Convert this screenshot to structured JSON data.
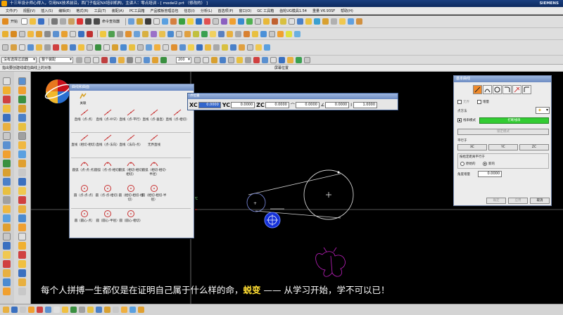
{
  "window": {
    "title": "十三年设计师心得入，引用NX技术前沿，西门子指定NX培训机构，主讲人：零点培训 - [ model2.prt （修改的） ]",
    "brand": "SIEMENS"
  },
  "menu": [
    "文件(F)",
    "视图(V)",
    "插入(S)",
    "编辑(E)",
    "格式(R)",
    "工具(T)",
    "装配(A)",
    "PC工具箱",
    "产品模板管理总包",
    "信息(I)",
    "分析(L)",
    "首选项(P)",
    "窗口(O)",
    "GC 工具箱",
    "齿轮UG模具1.54",
    "重量 V6.93SF",
    "帮助(H)"
  ],
  "toolbar1": {
    "start_label": "开始",
    "view_label": "命令查找器"
  },
  "selbar": {
    "filter": "没有选择过滤器",
    "scope": "整个装配",
    "zoom": "200"
  },
  "cue": {
    "left": "指出要创建线或在曲线上的对象",
    "status": "屏幕位置"
  },
  "curve_dialog": {
    "title": "曲线和曲面",
    "top_label": "关联",
    "items": [
      [
        "直线（点-点）",
        "直线（点-XYZ）",
        "直线（点-平行）",
        "直线（点-垂直）",
        "直线（点-相切）"
      ],
      [
        "直线（相切-相切）",
        "直线（点-法向）",
        "直线（法向-点）",
        "无界直线",
        ""
      ],
      [
        "圆弧（点-点-点）",
        "圆弧（点-点-相切）",
        "圆弧（相切-相切-相切）",
        "圆弧（相切-相切-半径）",
        ""
      ],
      [
        "圆（点-点-点）",
        "圆（点-点-相切）",
        "圆（相切-相切-相切）",
        "圆（相切-相切-半径）",
        ""
      ],
      [
        "圆（圆心-点）",
        "圆（圆心-半径）",
        "圆（圆心-相切）",
        "",
        ""
      ]
    ]
  },
  "point_bar": {
    "title": "点位置",
    "xc_label": "XC",
    "xc": "0.0000",
    "yc_label": "YC",
    "yc": "0.0000",
    "zc_label": "ZC",
    "zc": "0.0000",
    "len": "0.0000",
    "ang": "0.0000",
    "val": "1.0000"
  },
  "basic_dialog": {
    "title": "基本曲线",
    "unbounded_label": "无界",
    "incremental_label": "增量",
    "point_method_label": "点方法",
    "chain_label": "线串模式",
    "break_btn": "打断线串",
    "lock_btn": "锁定模式",
    "parallel_label": "平行于",
    "xc": "XC",
    "yc": "YC",
    "zc": "ZC",
    "offset_label": "按给定距离平行于",
    "original": "原始的",
    "new": "新的",
    "angle_label": "角度增量",
    "angle_value": "0.0000",
    "ok": "确定",
    "apply": "应用",
    "cancel": "取消"
  },
  "canvas": {
    "axis_label": "YC"
  },
  "subtitle": {
    "part1": "每个人拼搏一生都仅是在证明自己属于什么样的命，",
    "highlight": "蜕变",
    "part2": " —— 从学习开始，学不可以已！"
  }
}
